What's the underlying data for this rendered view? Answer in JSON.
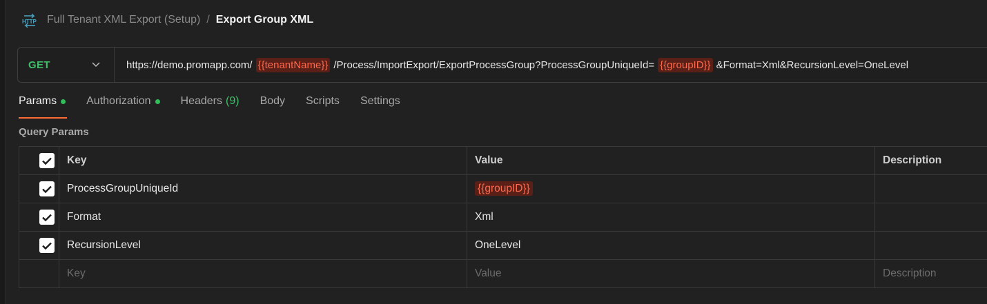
{
  "breadcrumb": {
    "icon": "http-icon",
    "parent": "Full Tenant XML Export (Setup)",
    "separator": "/",
    "current": "Export Group XML"
  },
  "request": {
    "method": "GET",
    "url_parts": {
      "p1": "https://demo.promapp.com/",
      "v1": "{{tenantName}}",
      "p2": "/Process/ImportExport/ExportProcessGroup?ProcessGroupUniqueId=",
      "v2": "{{groupID}}",
      "p3": "&Format=Xml&RecursionLevel=OneLevel"
    }
  },
  "tabs": {
    "params": "Params",
    "authorization": "Authorization",
    "headers": "Headers",
    "headers_count": "(9)",
    "body": "Body",
    "scripts": "Scripts",
    "settings": "Settings"
  },
  "query_params": {
    "title": "Query Params",
    "headers": {
      "key": "Key",
      "value": "Value",
      "description": "Description"
    },
    "rows": [
      {
        "key": "ProcessGroupUniqueId",
        "value": "{{groupID}}",
        "checked": true,
        "value_is_variable": true
      },
      {
        "key": "Format",
        "value": "Xml",
        "checked": true
      },
      {
        "key": "RecursionLevel",
        "value": "OneLevel",
        "checked": true
      }
    ],
    "placeholders": {
      "key": "Key",
      "value": "Value",
      "description": "Description"
    }
  },
  "colors": {
    "accent": "#ff6c37",
    "get_method": "#3fbf6a",
    "variable": "#ff6a4d",
    "dot": "#2fbf5a"
  }
}
